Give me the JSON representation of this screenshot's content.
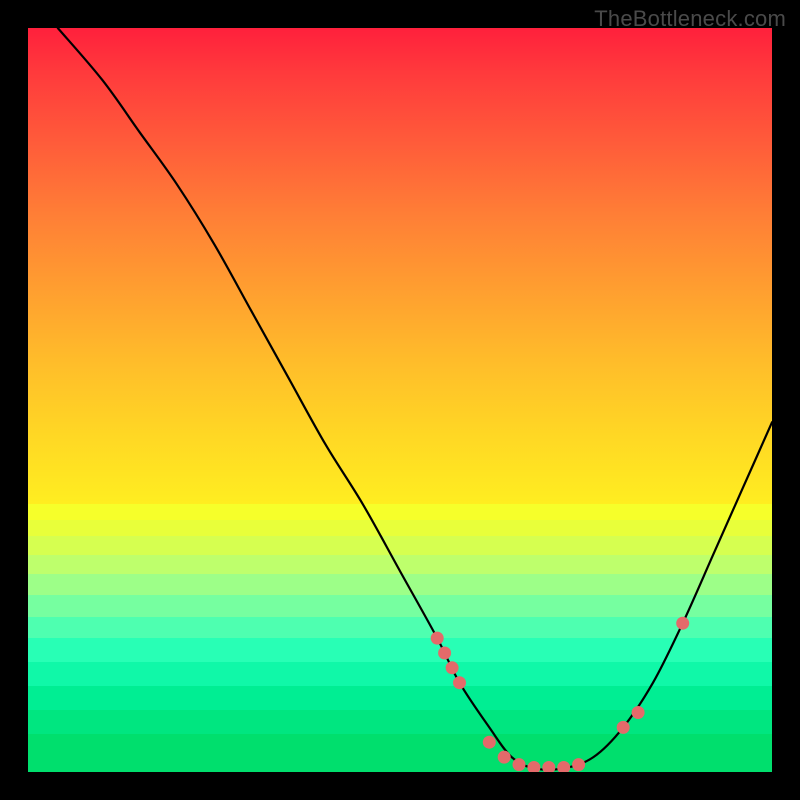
{
  "watermark": "TheBottleneck.com",
  "chart_data": {
    "type": "line",
    "title": "",
    "xlabel": "",
    "ylabel": "",
    "xlim": [
      0,
      100
    ],
    "ylim": [
      0,
      100
    ],
    "curve": {
      "name": "bottleneck-curve",
      "description": "V-shaped mismatch curve; high at left, falls to near zero around x≈65–75, rises toward right",
      "x": [
        4,
        10,
        15,
        20,
        25,
        30,
        35,
        40,
        45,
        50,
        55,
        58,
        62,
        65,
        68,
        72,
        76,
        80,
        84,
        88,
        92,
        96,
        100
      ],
      "values": [
        100,
        93,
        86,
        79,
        71,
        62,
        53,
        44,
        36,
        27,
        18,
        12,
        6,
        2,
        0.5,
        0.5,
        2,
        6,
        12,
        20,
        29,
        38,
        47
      ]
    },
    "markers": {
      "name": "sample-points",
      "color": "#e46a6a",
      "x": [
        55,
        56,
        57,
        58,
        62,
        64,
        66,
        68,
        70,
        72,
        74,
        80,
        82,
        88
      ],
      "values": [
        18,
        16,
        14,
        12,
        4,
        2,
        1,
        0.6,
        0.6,
        0.6,
        1,
        6,
        8,
        20
      ]
    },
    "gradient_stops": [
      {
        "pos": 0,
        "color": "#ff203c"
      },
      {
        "pos": 50,
        "color": "#ffd824"
      },
      {
        "pos": 75,
        "color": "#e1ff3a"
      },
      {
        "pos": 100,
        "color": "#00e47f"
      }
    ]
  }
}
